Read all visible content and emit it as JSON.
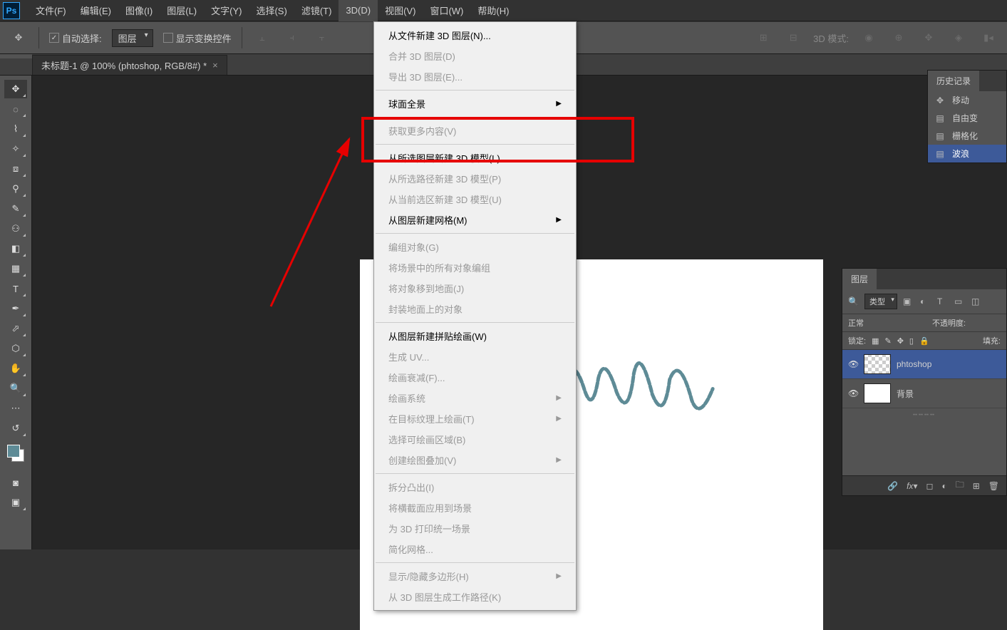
{
  "menubar": {
    "items": [
      "文件(F)",
      "编辑(E)",
      "图像(I)",
      "图层(L)",
      "文字(Y)",
      "选择(S)",
      "滤镜(T)",
      "3D(D)",
      "视图(V)",
      "窗口(W)",
      "帮助(H)"
    ],
    "active_index": 7
  },
  "options": {
    "auto_select_label": "自动选择:",
    "auto_select_dropdown": "图层",
    "show_transform_label": "显示变换控件",
    "mode_label": "3D 模式:"
  },
  "doc_tab": {
    "title": "未标题-1 @ 100% (phtoshop, RGB/8#) *"
  },
  "dropdown": {
    "items": [
      {
        "label": "从文件新建 3D 图层(N)...",
        "enabled": true
      },
      {
        "label": "合并 3D 图层(D)",
        "enabled": false
      },
      {
        "label": "导出 3D 图层(E)...",
        "enabled": false
      },
      {
        "sep": true
      },
      {
        "label": "球面全景",
        "enabled": true,
        "sub": true
      },
      {
        "sep": true
      },
      {
        "label": "获取更多内容(V)",
        "enabled": false
      },
      {
        "sep": true
      },
      {
        "label": "从所选图层新建 3D 模型(L)",
        "enabled": true
      },
      {
        "label": "从所选路径新建 3D 模型(P)",
        "enabled": false
      },
      {
        "label": "从当前选区新建 3D 模型(U)",
        "enabled": false
      },
      {
        "label": "从图层新建网格(M)",
        "enabled": true,
        "sub": true
      },
      {
        "sep": true
      },
      {
        "label": "编组对象(G)",
        "enabled": false
      },
      {
        "label": "将场景中的所有对象编组",
        "enabled": false
      },
      {
        "label": "将对象移到地面(J)",
        "enabled": false
      },
      {
        "label": "封装地面上的对象",
        "enabled": false
      },
      {
        "sep": true
      },
      {
        "label": "从图层新建拼贴绘画(W)",
        "enabled": true
      },
      {
        "label": "生成 UV...",
        "enabled": false
      },
      {
        "label": "绘画衰减(F)...",
        "enabled": false
      },
      {
        "label": "绘画系统",
        "enabled": false,
        "sub": true
      },
      {
        "label": "在目标纹理上绘画(T)",
        "enabled": false,
        "sub": true
      },
      {
        "label": "选择可绘画区域(B)",
        "enabled": false
      },
      {
        "label": "创建绘图叠加(V)",
        "enabled": false,
        "sub": true
      },
      {
        "sep": true
      },
      {
        "label": "拆分凸出(I)",
        "enabled": false
      },
      {
        "label": "将横截面应用到场景",
        "enabled": false
      },
      {
        "label": "为 3D 打印统一场景",
        "enabled": false
      },
      {
        "label": "简化网格...",
        "enabled": false
      },
      {
        "sep": true
      },
      {
        "label": "显示/隐藏多边形(H)",
        "enabled": false,
        "sub": true
      },
      {
        "label": "从 3D 图层生成工作路径(K)",
        "enabled": false
      }
    ]
  },
  "history_panel": {
    "title": "历史记录",
    "items": [
      {
        "icon": "✥",
        "label": "移动"
      },
      {
        "icon": "▤",
        "label": "自由变"
      },
      {
        "icon": "▤",
        "label": "栅格化"
      },
      {
        "icon": "▤",
        "label": "波浪",
        "active": true
      }
    ]
  },
  "layers_panel": {
    "title": "图层",
    "type_label": "类型",
    "blend_mode": "正常",
    "opacity_label": "不透明度:",
    "lock_label": "锁定:",
    "fill_label": "填充:",
    "layers": [
      {
        "name": "phtoshop",
        "selected": true,
        "checker": true
      },
      {
        "name": "背景",
        "selected": false,
        "checker": false
      }
    ]
  },
  "search_icon": "🔍"
}
